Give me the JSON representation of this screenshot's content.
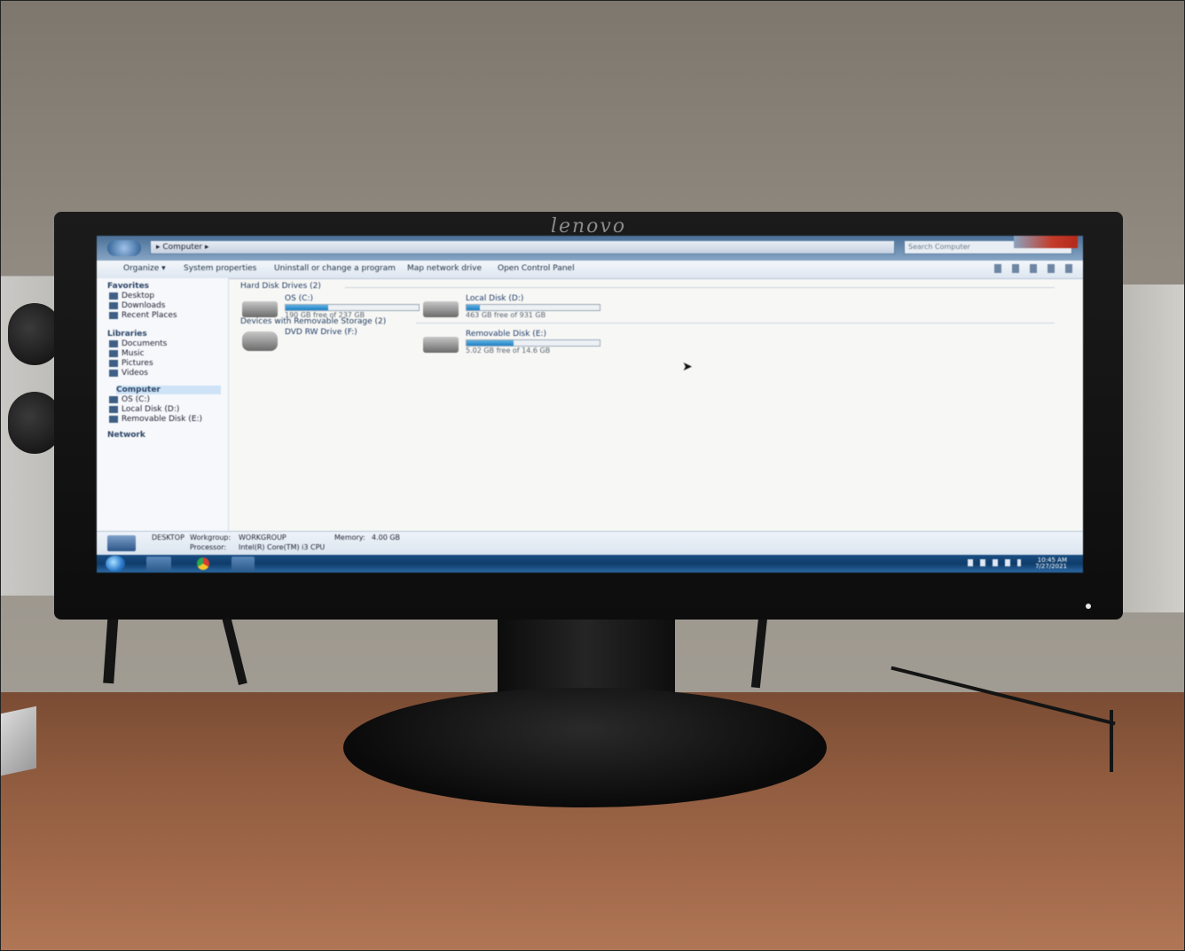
{
  "scene": {
    "monitor_brand": "lenovo"
  },
  "explorer": {
    "address": "▸ Computer ▸",
    "search_placeholder": "Search Computer",
    "toolbar": [
      "Organize ▾",
      "System properties",
      "Uninstall or change a program",
      "Map network drive",
      "Open Control Panel"
    ],
    "nav": {
      "favorites": "Favorites",
      "desktop": "Desktop",
      "downloads": "Downloads",
      "recent": "Recent Places",
      "libraries": "Libraries",
      "documents": "Documents",
      "music": "Music",
      "pictures": "Pictures",
      "videos": "Videos",
      "computer": "Computer",
      "os": "OS (C:)",
      "local_disk": "Local Disk (D:)",
      "removable": "Removable Disk (E:)",
      "network": "Network"
    },
    "groups": {
      "hard_disks": "Hard Disk Drives (2)",
      "removable": "Devices with Removable Storage (2)"
    },
    "drives": [
      {
        "name": "OS (C:)",
        "free": "190 GB free of 237 GB",
        "used_fraction": 0.32
      },
      {
        "name": "Local Disk (D:)",
        "free": "463 GB free of 931 GB",
        "used_fraction": 0.1
      },
      {
        "name": "DVD RW Drive (F:)",
        "free": "",
        "used_fraction": null
      },
      {
        "name": "Removable Disk (E:)",
        "free": "5.02 GB free of 14.6 GB",
        "used_fraction": 0.35
      }
    ],
    "details": {
      "name": "DESKTOP",
      "workgroup_label": "Workgroup:",
      "workgroup": "WORKGROUP",
      "memory_label": "Memory:",
      "memory": "4.00 GB",
      "processor_label": "Processor:",
      "processor": "Intel(R) Core(TM) i3 CPU"
    },
    "taskbar": {
      "time": "10:45 AM",
      "date": "7/27/2021"
    }
  }
}
